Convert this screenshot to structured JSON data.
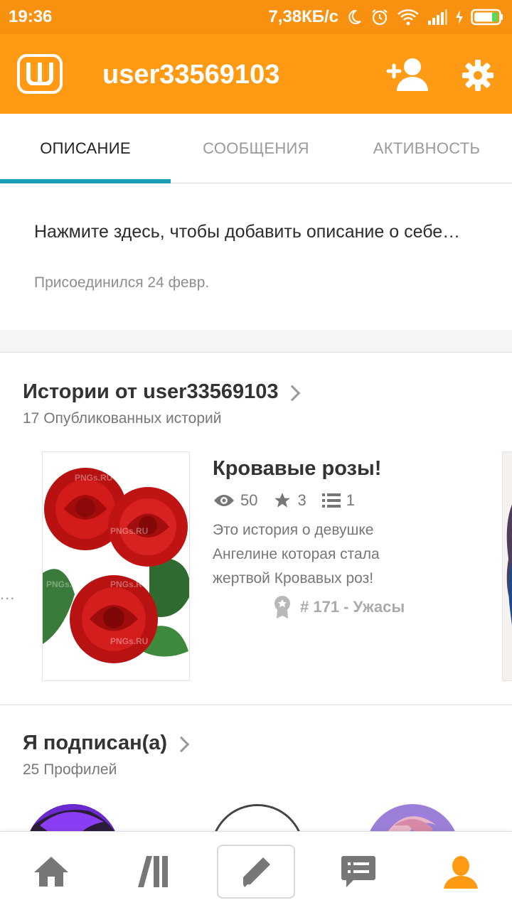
{
  "status_bar": {
    "time": "19:36",
    "net_speed": "7,38КБ/с"
  },
  "app_bar": {
    "logo_letter": "Ш",
    "username": "user33569103"
  },
  "tabs": [
    {
      "label": "ОПИСАНИЕ",
      "active": true
    },
    {
      "label": "СООБЩЕНИЯ",
      "active": false
    },
    {
      "label": "АКТИВНОСТЬ",
      "active": false
    }
  ],
  "profile": {
    "description_prompt": "Нажмите здесь, чтобы добавить описание о себе…",
    "joined": "Присоединился 24 февр."
  },
  "stories": {
    "title": "Истории от user33569103",
    "count_label": "17 Опубликованных историй",
    "featured": {
      "cover_watermark": "PNGs.RU",
      "title": "Кровавые розы!",
      "views": "50",
      "votes": "3",
      "parts": "1",
      "blurb": "Это история о девушке Ангелине которая стала жертвой Кровавых роз!",
      "rank": "# 171 - Ужасы"
    },
    "prev_peek": "..."
  },
  "following": {
    "title": "Я подписан(а)",
    "count_label": "25 Профилей"
  },
  "bottom_nav": [
    "home-icon",
    "library-icon",
    "write-icon",
    "messages-icon",
    "profile-icon"
  ],
  "colors": {
    "accent_orange": "#ff9a14",
    "status_orange": "#f8910f",
    "tab_indicator": "#1a9fb4"
  }
}
